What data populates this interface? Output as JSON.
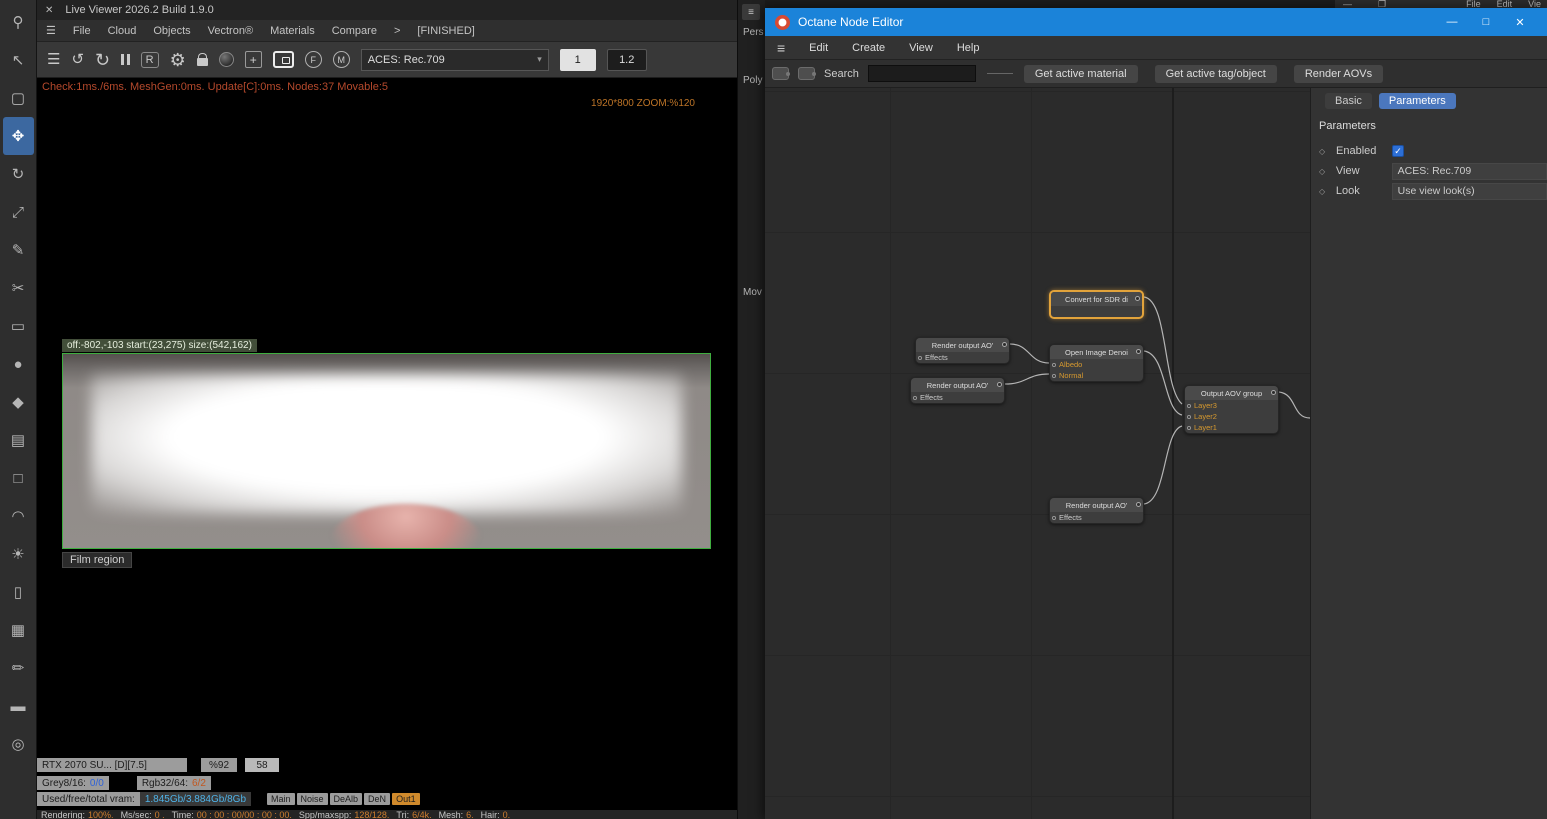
{
  "background_window": {
    "minimize_glyph": "—",
    "maximize_glyph": "❐",
    "menu_items": [
      "File",
      "Edit",
      "Vie"
    ]
  },
  "left_toolbar": {
    "tools": [
      {
        "name": "zoom-tool-icon",
        "glyph": "⚲"
      },
      {
        "name": "select-tool-icon",
        "glyph": "↖"
      },
      {
        "name": "marquee-tool-icon",
        "glyph": "▢"
      },
      {
        "name": "move-tool-icon",
        "glyph": "✥"
      },
      {
        "name": "rotate-tool-icon",
        "glyph": "↻"
      },
      {
        "name": "scale-tool-icon",
        "glyph": "⤢"
      },
      {
        "name": "pen-tool-icon",
        "glyph": "✎"
      },
      {
        "name": "knife-tool-icon",
        "glyph": "✂"
      },
      {
        "name": "plane-object-icon",
        "glyph": "▭"
      },
      {
        "name": "sphere-object-icon",
        "glyph": "●"
      },
      {
        "name": "cube-object-icon",
        "glyph": "◆"
      },
      {
        "name": "layers-object-icon",
        "glyph": "▤"
      },
      {
        "name": "cube-outline-icon",
        "glyph": "□"
      },
      {
        "name": "arch-object-icon",
        "glyph": "◠"
      },
      {
        "name": "light-object-icon",
        "glyph": "☀"
      },
      {
        "name": "cylinder-object-icon",
        "glyph": "▯"
      },
      {
        "name": "boxes-object-icon",
        "glyph": "▦"
      },
      {
        "name": "pencil-tool-icon",
        "glyph": "✏"
      },
      {
        "name": "bed-object-icon",
        "glyph": "▬"
      },
      {
        "name": "target-tool-icon",
        "glyph": "◎"
      }
    ]
  },
  "live_viewer": {
    "close_glyph": "✕",
    "title": "Live Viewer 2026.2 Build 1.9.0",
    "menu_glyph": "☰",
    "menu_items": [
      "File",
      "Cloud",
      "Objects",
      "Vectron®",
      "Materials",
      "Compare",
      ">",
      "[FINISHED]"
    ],
    "toolbar": {
      "restart_glyph": "↺",
      "refresh_glyph": "↻",
      "r_label": "R",
      "gear_glyph": "⚙",
      "plus_glyph": "+",
      "f_label": "F",
      "m_label": "M",
      "colorspace": "ACES: Rec.709",
      "caret": "▾",
      "res_value": "1",
      "gamma_value": "1.2"
    },
    "status_line": "Check:1ms./6ms. MeshGen:0ms. Update[C]:0ms. Nodes:37 Movable:5",
    "zoom_info": "1920*800 ZOOM:%120",
    "region_info": "off:-802,-103 start:(23,275) size:(542,162)",
    "film_region_label": "Film region",
    "stats": {
      "gpu_name": "RTX 2070 SU... [D][7.5]",
      "gpu_load": "%92",
      "gpu_temp": "58",
      "grey_label": "Grey8/16:",
      "grey_value": "0/0",
      "rgb_label": "Rgb32/64:",
      "rgb_value": "6/2",
      "vram_label": "Used/free/total vram:",
      "vram_value": "1.845Gb/3.884Gb/8Gb",
      "passes": [
        "Main",
        "Noise",
        "DeAlb",
        "DeN",
        "Out1"
      ],
      "active_pass": "Out1"
    },
    "render_bar": {
      "segments": [
        {
          "label": "Rendering:",
          "value": "100%."
        },
        {
          "label": "Ms/sec:",
          "value": "0 ."
        },
        {
          "label": "Time:",
          "value": "00 : 00 : 00/00 : 00 : 00."
        },
        {
          "label": "Spp/maxspp:",
          "value": "128/128."
        },
        {
          "label": "Tri:",
          "value": "6/4k."
        },
        {
          "label": "Mesh:",
          "value": "6."
        },
        {
          "label": "Hair:",
          "value": "0."
        }
      ]
    }
  },
  "viewport_strip": {
    "menu_glyph": "≡",
    "labels": [
      "Pers",
      "Poly",
      "Mov"
    ]
  },
  "node_editor": {
    "title": "Octane Node Editor",
    "window_buttons": {
      "minimize": "—",
      "maximize": "□",
      "close": "✕"
    },
    "menu_glyph": "≡",
    "menu_items": [
      "Edit",
      "Create",
      "View",
      "Help"
    ],
    "toolbar": {
      "search_label": "Search",
      "buttons": [
        "Get active material",
        "Get active tag/object",
        "Render AOVs"
      ]
    },
    "panel": {
      "diamond_glyph": "◇",
      "tabs": [
        {
          "label": "Basic",
          "active": false
        },
        {
          "label": "Parameters",
          "active": true
        }
      ],
      "header": "Parameters",
      "rows": [
        {
          "label": "Enabled",
          "checked": true,
          "check_glyph": "✓"
        },
        {
          "label": "View",
          "value": "ACES: Rec.709"
        },
        {
          "label": "Look",
          "value": "Use view look(s)"
        }
      ]
    },
    "nodes": [
      {
        "title": "Render output AO'",
        "rows": [
          "Effects"
        ],
        "selected": false
      },
      {
        "title": "Render output AO'",
        "rows": [
          "Effects"
        ],
        "selected": false
      },
      {
        "title": "Convert for SDR di",
        "rows": [],
        "selected": true
      },
      {
        "title": "Open Image Denoi",
        "rows": [
          "Albedo",
          "Normal"
        ],
        "selected": false
      },
      {
        "title": "Output AOV group",
        "rows": [
          "Layer3",
          "Layer2",
          "Layer1"
        ],
        "selected": false
      },
      {
        "title": "Render output AO'",
        "rows": [
          "Effects"
        ],
        "selected": false
      }
    ]
  }
}
